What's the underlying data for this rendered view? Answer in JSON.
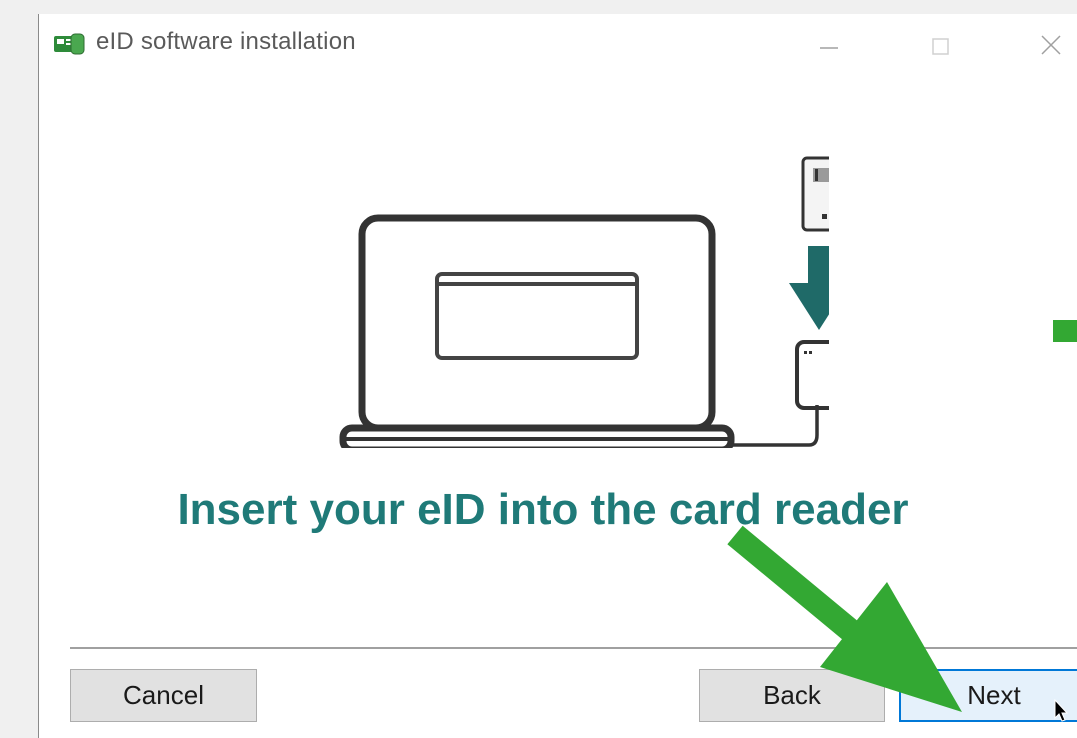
{
  "window": {
    "title": "eID software installation",
    "icon": "eid-card-reader-app-icon"
  },
  "titlebar_controls": {
    "minimize_icon": "minimize-icon",
    "maximize_icon": "maximize-icon",
    "close_icon": "close-icon"
  },
  "main": {
    "illustration_icon": "laptop-card-reader-illustration",
    "instruction": "Insert your eID into the card reader"
  },
  "buttons": {
    "cancel": "Cancel",
    "back": "Back",
    "next": "Next"
  },
  "colors": {
    "accent": "#1f7a78",
    "annotation": "#33a833",
    "focus_border": "#0078d7"
  }
}
